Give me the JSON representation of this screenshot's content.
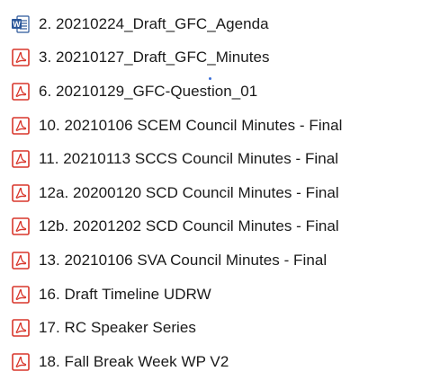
{
  "colors": {
    "pdf_red": "#d8362b",
    "word_blue": "#2b579a",
    "text": "#1a1a1a"
  },
  "files": [
    {
      "name": "2. 20210224_Draft_GFC_Agenda",
      "icon": "word-doc-icon"
    },
    {
      "name": "3. 20210127_Draft_GFC_Minutes",
      "icon": "pdf-icon"
    },
    {
      "name": "6. 20210129_GFC-Question_01",
      "icon": "pdf-icon"
    },
    {
      "name": "10. 20210106 SCEM Council Minutes - Final",
      "icon": "pdf-icon"
    },
    {
      "name": "11. 20210113 SCCS Council Minutes - Final",
      "icon": "pdf-icon"
    },
    {
      "name": "12a. 20200120 SCD Council Minutes - Final",
      "icon": "pdf-icon"
    },
    {
      "name": "12b. 20201202 SCD Council Minutes - Final",
      "icon": "pdf-icon"
    },
    {
      "name": "13. 20210106 SVA Council Minutes - Final",
      "icon": "pdf-icon"
    },
    {
      "name": "16. Draft Timeline UDRW",
      "icon": "pdf-icon"
    },
    {
      "name": "17. RC Speaker Series",
      "icon": "pdf-icon"
    },
    {
      "name": "18. Fall Break Week WP V2",
      "icon": "pdf-icon"
    }
  ]
}
